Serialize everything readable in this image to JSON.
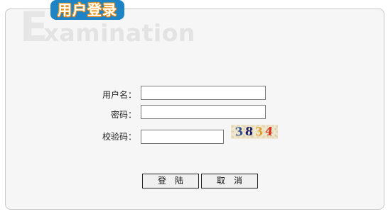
{
  "header": {
    "title": "用户登录",
    "watermark_initial": "E",
    "watermark_rest": "xamination"
  },
  "form": {
    "username_label": "用户名：",
    "username_value": "",
    "password_label": "密码：",
    "password_value": "",
    "captcha_label": "校验码：",
    "captcha_value": "",
    "captcha_chars": [
      "3",
      "8",
      "3",
      "4"
    ],
    "captcha_colors": [
      "#2f4f8f",
      "#1a1a6a",
      "#e0a030",
      "#d8301a"
    ]
  },
  "buttons": {
    "login_label": "登陆",
    "cancel_label": "取消"
  },
  "colors": {
    "badge_bg": "#1f84c6",
    "badge_outline": "#e8730c",
    "panel_bg": "#f6f6f6"
  }
}
